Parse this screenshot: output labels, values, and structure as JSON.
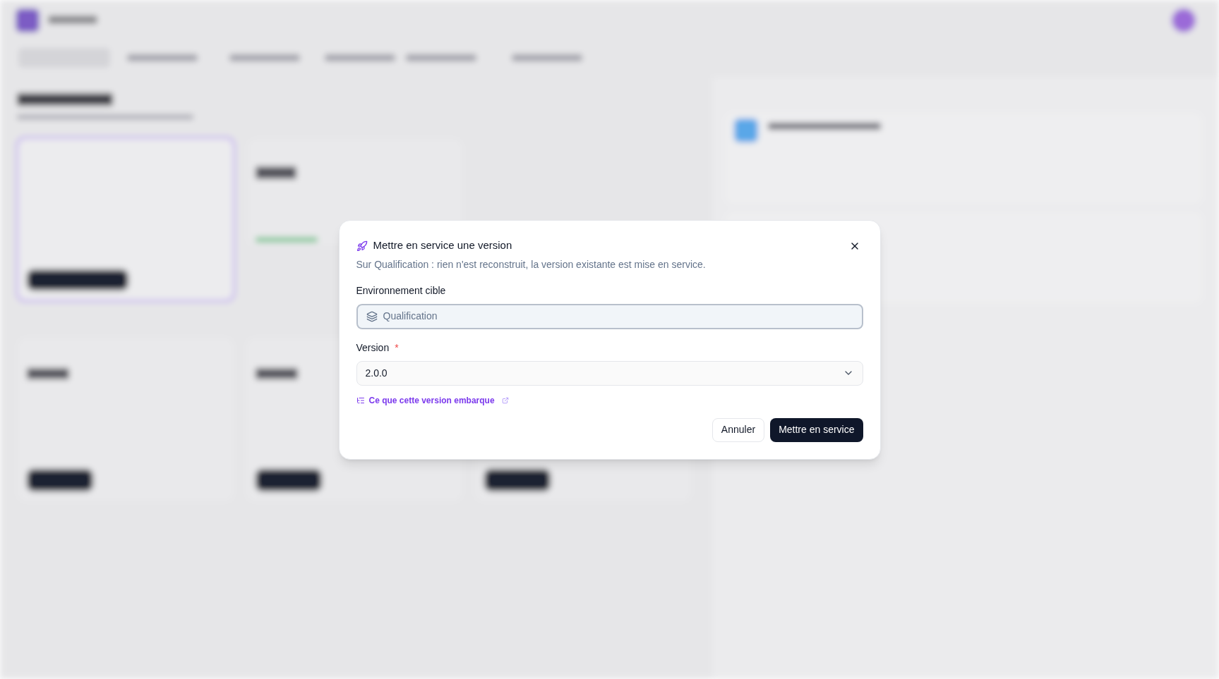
{
  "dialog": {
    "title": "Mettre en service une version",
    "description": "Sur Qualification : rien n'est reconstruit, la version existante est mise en service.",
    "fields": [
      {
        "kind": "text",
        "label": "Environnement cible",
        "value": "Qualification",
        "disabled": true,
        "required": false
      },
      {
        "kind": "select",
        "label": "Version",
        "value": "2.0.0",
        "disabled": false,
        "required": true
      }
    ],
    "required_mark": "*",
    "link": "Ce que cette version embarque",
    "buttons": [
      {
        "kind": "secondary",
        "label": "Annuler"
      },
      {
        "kind": "primary",
        "label": "Mettre en service"
      }
    ]
  }
}
